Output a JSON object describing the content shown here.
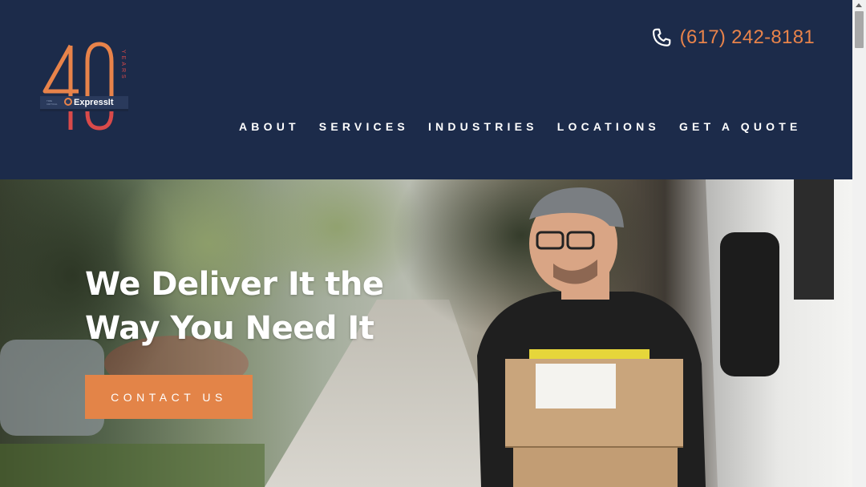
{
  "header": {
    "logo": {
      "big_number": "40",
      "years_label": "YEARS",
      "brand": "ExpressIt",
      "tagline": "TIME CRITICAL DELIVERY",
      "colors": {
        "number": "#e8834a",
        "years": "#d94a4a",
        "banner": "#2a3a5c"
      }
    },
    "phone": {
      "icon": "phone-icon",
      "number": "(617) 242-8181"
    },
    "nav": [
      {
        "label": "ABOUT"
      },
      {
        "label": "SERVICES"
      },
      {
        "label": "INDUSTRIES"
      },
      {
        "label": "LOCATIONS"
      },
      {
        "label": "GET A QUOTE"
      }
    ]
  },
  "hero": {
    "headline": "We Deliver It the Way You Need It",
    "cta_label": "CONTACT US",
    "image_subject": "delivery-courier-with-boxes"
  },
  "colors": {
    "navy": "#1c2b4a",
    "accent": "#e38448",
    "white": "#ffffff"
  }
}
